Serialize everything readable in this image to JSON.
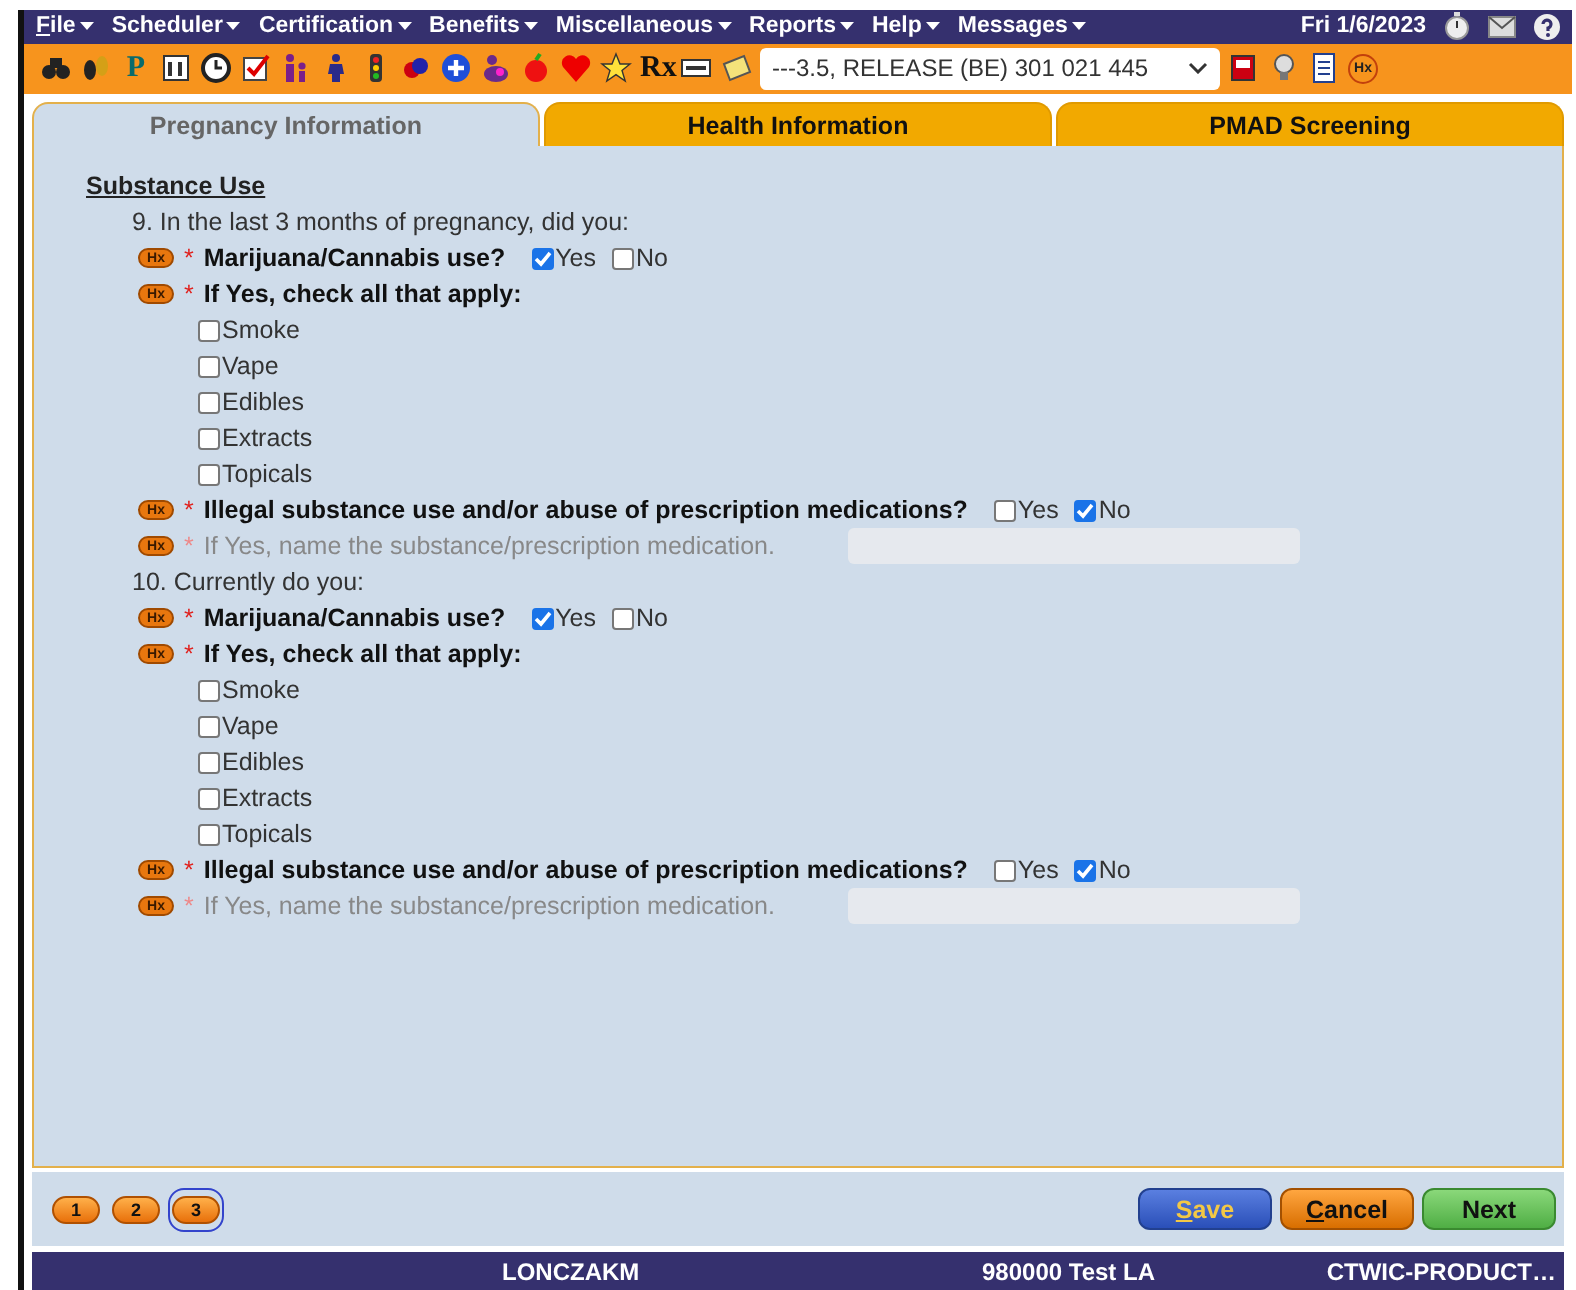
{
  "menu": {
    "items": [
      {
        "key": "F",
        "rest": "ile"
      },
      {
        "rest": "Scheduler"
      },
      {
        "rest": "Certification"
      },
      {
        "rest": "Benefits"
      },
      {
        "rest": "Miscellaneous"
      },
      {
        "rest": "Reports"
      },
      {
        "rest": "Help"
      },
      {
        "rest": "Messages"
      }
    ],
    "date": "Fri 1/6/2023"
  },
  "toolbar": {
    "p_label": "P",
    "rx_label": "Rx",
    "select_value": "---3.5, RELEASE (BE) 301 021 445",
    "hx_label": "Hx"
  },
  "tabs": [
    {
      "label": "Pregnancy Information",
      "selected": true
    },
    {
      "label": "Health Information",
      "selected": false
    },
    {
      "label": "PMAD Screening",
      "selected": false
    }
  ],
  "section_title": "Substance Use",
  "questions": [
    {
      "heading": "9. In the last 3 months of pregnancy, did you:",
      "items": [
        {
          "kind": "yesno",
          "badge": "Hx",
          "mark": "*",
          "label": "Marijuana/Cannabis use?",
          "options": [
            {
              "label": "Yes",
              "checked": true
            },
            {
              "label": "No",
              "checked": false
            }
          ]
        },
        {
          "kind": "checklist",
          "badge": "Hx",
          "mark": "*",
          "label": "If Yes, check all that apply:",
          "options": [
            {
              "label": "Smoke",
              "checked": false
            },
            {
              "label": "Vape",
              "checked": false
            },
            {
              "label": "Edibles",
              "checked": false
            },
            {
              "label": "Extracts",
              "checked": false
            },
            {
              "label": "Topicals",
              "checked": false
            }
          ]
        },
        {
          "kind": "yesno",
          "badge": "Hx",
          "mark": "*",
          "label": "Illegal substance use and/or abuse of prescription medications?",
          "options": [
            {
              "label": "Yes",
              "checked": false
            },
            {
              "label": "No",
              "checked": true
            }
          ]
        },
        {
          "kind": "text",
          "badge": "Hx",
          "mark": "*",
          "label": "If Yes, name the substance/prescription medication.",
          "disabled": true
        }
      ]
    },
    {
      "heading": "10. Currently do you:",
      "items": [
        {
          "kind": "yesno",
          "badge": "Hx",
          "mark": "*",
          "label": "Marijuana/Cannabis use?",
          "options": [
            {
              "label": "Yes",
              "checked": true
            },
            {
              "label": "No",
              "checked": false
            }
          ]
        },
        {
          "kind": "checklist",
          "badge": "Hx",
          "mark": "*",
          "label": "If Yes, check all that apply:",
          "options": [
            {
              "label": "Smoke",
              "checked": false
            },
            {
              "label": "Vape",
              "checked": false
            },
            {
              "label": "Edibles",
              "checked": false
            },
            {
              "label": "Extracts",
              "checked": false
            },
            {
              "label": "Topicals",
              "checked": false
            }
          ]
        },
        {
          "kind": "yesno",
          "badge": "Hx",
          "mark": "*",
          "label": "Illegal substance use and/or abuse of prescription medications?",
          "options": [
            {
              "label": "Yes",
              "checked": false
            },
            {
              "label": "No",
              "checked": true
            }
          ]
        },
        {
          "kind": "text",
          "badge": "Hx",
          "mark": "*",
          "label": "If Yes, name the substance/prescription medication.",
          "disabled": true
        }
      ]
    }
  ],
  "pages": [
    {
      "label": "1",
      "selected": false
    },
    {
      "label": "2",
      "selected": false
    },
    {
      "label": "3",
      "selected": true
    }
  ],
  "buttons": [
    {
      "kind": "save",
      "key": "S",
      "rest": "ave"
    },
    {
      "kind": "cancel",
      "key": "C",
      "rest": "ancel"
    },
    {
      "kind": "next",
      "rest": "Next"
    }
  ],
  "status_bar": {
    "user": "LONCZAKM",
    "clinic": "980000 Test LA",
    "server": "CTWIC-PRODUCT…"
  }
}
